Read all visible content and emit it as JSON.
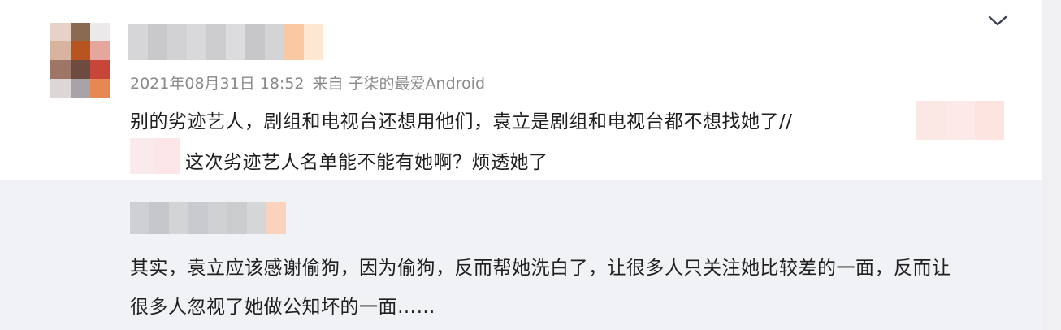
{
  "comment": {
    "timestamp": "2021年08月31日 18:52",
    "source": "来自 子柒的最爱Android",
    "line1": "别的劣迹艺人，剧组和电视台还想用他们，袁立是剧组和电视台都不想找她了//",
    "line2": "这次劣迹艺人名单能不能有她啊？烦透她了",
    "expand_icon": "chevron-down-icon"
  },
  "reply": {
    "line1": "其实，袁立应该感谢偷狗，因为偷狗，反而帮她洗白了，让很多人只关注她比较差的一面，反而让",
    "line2": "很多人忽视了她做公知坏的一面……"
  },
  "colors": {
    "reply_background": "#f1f2f5",
    "meta_text": "#8a8a8a",
    "body_text": "#1f1f1f"
  }
}
